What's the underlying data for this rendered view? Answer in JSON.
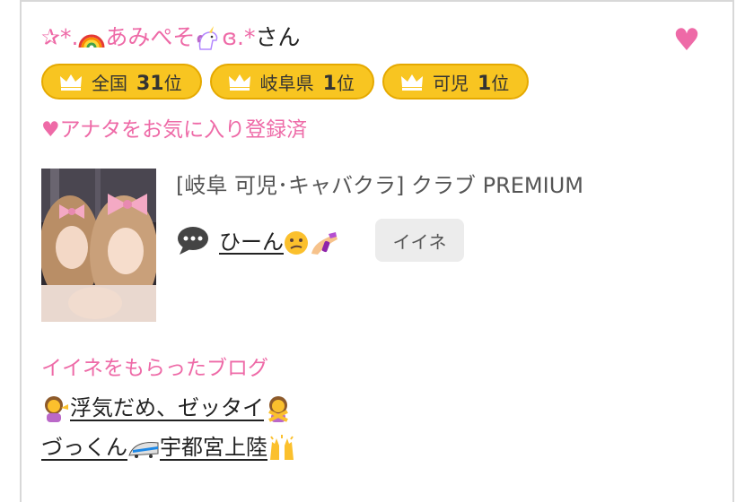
{
  "user": {
    "name_prefix": "✰*.",
    "name_mid": "あみぺそ",
    "name_suffix": "ɞ.*",
    "honorific": "さん",
    "rainbow_icon": "rainbow-emoji",
    "unicorn_icon": "unicorn-emoji",
    "favorite_icon": "heart-icon"
  },
  "rankings": [
    {
      "area": "全国",
      "rank": "31",
      "unit": "位"
    },
    {
      "area": "岐阜県",
      "rank": "1",
      "unit": "位"
    },
    {
      "area": "可児",
      "rank": "1",
      "unit": "位"
    }
  ],
  "favorite_status": "♥アナタをお気に入り登録済",
  "shop": {
    "text": "[岐阜 可児･キャバクラ]  クラブ PREMIUM"
  },
  "comment": {
    "text": "ひーん"
  },
  "iine_button": "イイネ",
  "blog": {
    "heading": "イイネをもらったブログ",
    "posts": [
      {
        "title": "浮気だめ、ゼッタイ"
      },
      {
        "prefix": "づっくん",
        "suffix": "宇都宮上陸"
      }
    ]
  },
  "colors": {
    "accent_pink": "#ee6aa7",
    "badge_gold": "#f8c521",
    "button_gray": "#ececec"
  }
}
